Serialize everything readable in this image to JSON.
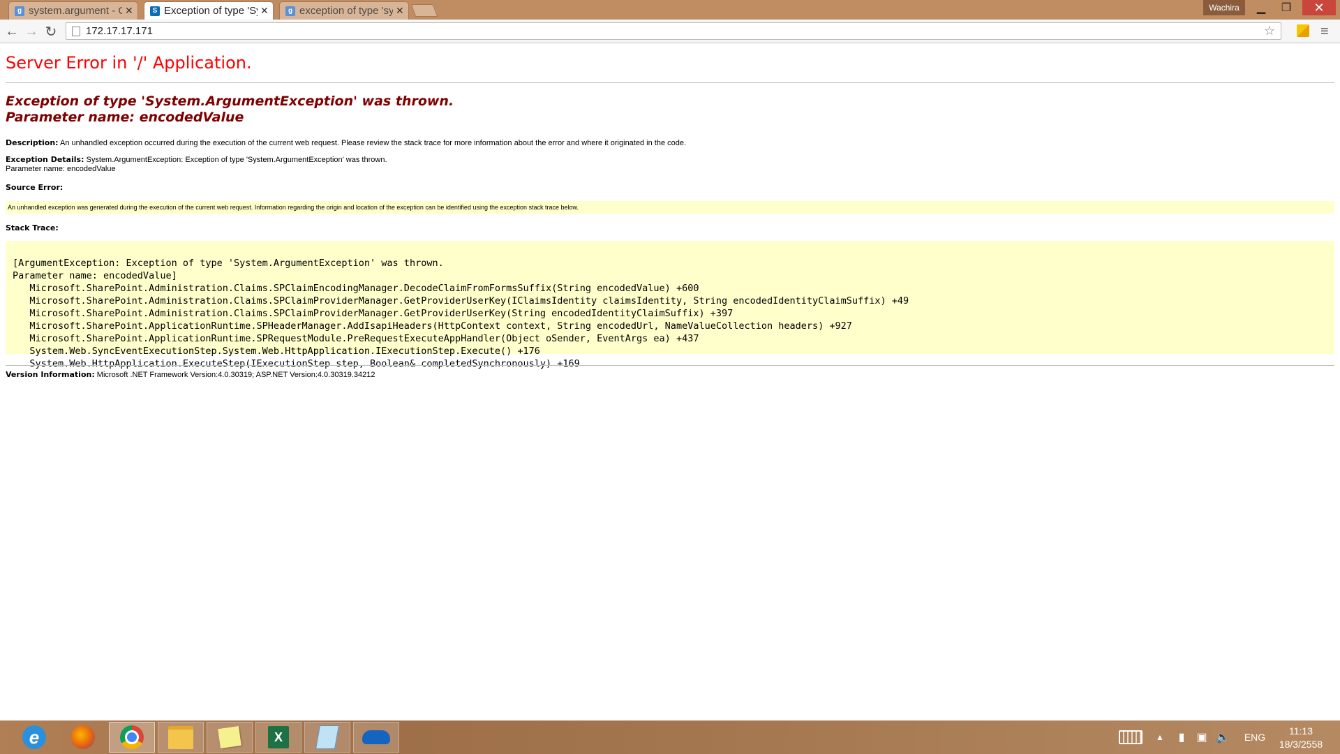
{
  "browser": {
    "tabs": [
      {
        "title": "system.argument - G",
        "favicon": "google-icon",
        "active": false
      },
      {
        "title": "Exception of type 'Sy",
        "favicon": "sharepoint-icon",
        "active": true
      },
      {
        "title": "exception of type 'sy",
        "favicon": "google-icon",
        "active": false
      }
    ],
    "user_name": "Wachira",
    "url": "172.17.17.171"
  },
  "page": {
    "title": "Server Error in '/' Application.",
    "exception_line1": "Exception of type 'System.ArgumentException' was thrown.",
    "exception_line2": "Parameter name: encodedValue",
    "description_label": "Description:",
    "description_text": "An unhandled exception occurred during the execution of the current web request. Please review the stack trace for more information about the error and where it originated in the code.",
    "details_label": "Exception Details:",
    "details_text": "System.ArgumentException: Exception of type 'System.ArgumentException' was thrown.",
    "details_param": "Parameter name: encodedValue",
    "source_error_label": "Source Error:",
    "source_error_text": "An unhandled exception was generated during the execution of the current web request. Information regarding the origin and location of the exception can be identified using the exception stack trace below.",
    "stack_trace_label": "Stack Trace:",
    "stack_lines": [
      "[ArgumentException: Exception of type 'System.ArgumentException' was thrown.",
      "Parameter name: encodedValue]",
      "   Microsoft.SharePoint.Administration.Claims.SPClaimEncodingManager.DecodeClaimFromFormsSuffix(String encodedValue) +600",
      "   Microsoft.SharePoint.Administration.Claims.SPClaimProviderManager.GetProviderUserKey(IClaimsIdentity claimsIdentity, String encodedIdentityClaimSuffix) +49",
      "   Microsoft.SharePoint.Administration.Claims.SPClaimProviderManager.GetProviderUserKey(String encodedIdentityClaimSuffix) +397",
      "   Microsoft.SharePoint.ApplicationRuntime.SPHeaderManager.AddIsapiHeaders(HttpContext context, String encodedUrl, NameValueCollection headers) +927",
      "   Microsoft.SharePoint.ApplicationRuntime.SPRequestModule.PreRequestExecuteAppHandler(Object oSender, EventArgs ea) +437",
      "   System.Web.SyncEventExecutionStep.System.Web.HttpApplication.IExecutionStep.Execute() +176",
      "   System.Web.HttpApplication.ExecuteStep(IExecutionStep step, Boolean& completedSynchronously) +169"
    ],
    "version_label": "Version Information:",
    "version_text": "Microsoft .NET Framework Version:4.0.30319; ASP.NET Version:4.0.30319.34212"
  },
  "taskbar": {
    "apps": [
      {
        "name": "internet-explorer-icon",
        "state": "none"
      },
      {
        "name": "firefox-icon",
        "state": "none"
      },
      {
        "name": "chrome-icon",
        "state": "active"
      },
      {
        "name": "file-explorer-icon",
        "state": "pinned"
      },
      {
        "name": "sticky-notes-icon",
        "state": "pinned"
      },
      {
        "name": "excel-icon",
        "state": "pinned"
      },
      {
        "name": "notepad-icon",
        "state": "pinned"
      },
      {
        "name": "onedrive-icon",
        "state": "pinned"
      }
    ],
    "language": "ENG",
    "time": "11:13",
    "date": "18/3/2558"
  },
  "colors": {
    "error_title": "#ff0000",
    "exception_heading": "#800000",
    "code_background": "#ffffcc",
    "titlebar": "#c08c62"
  }
}
